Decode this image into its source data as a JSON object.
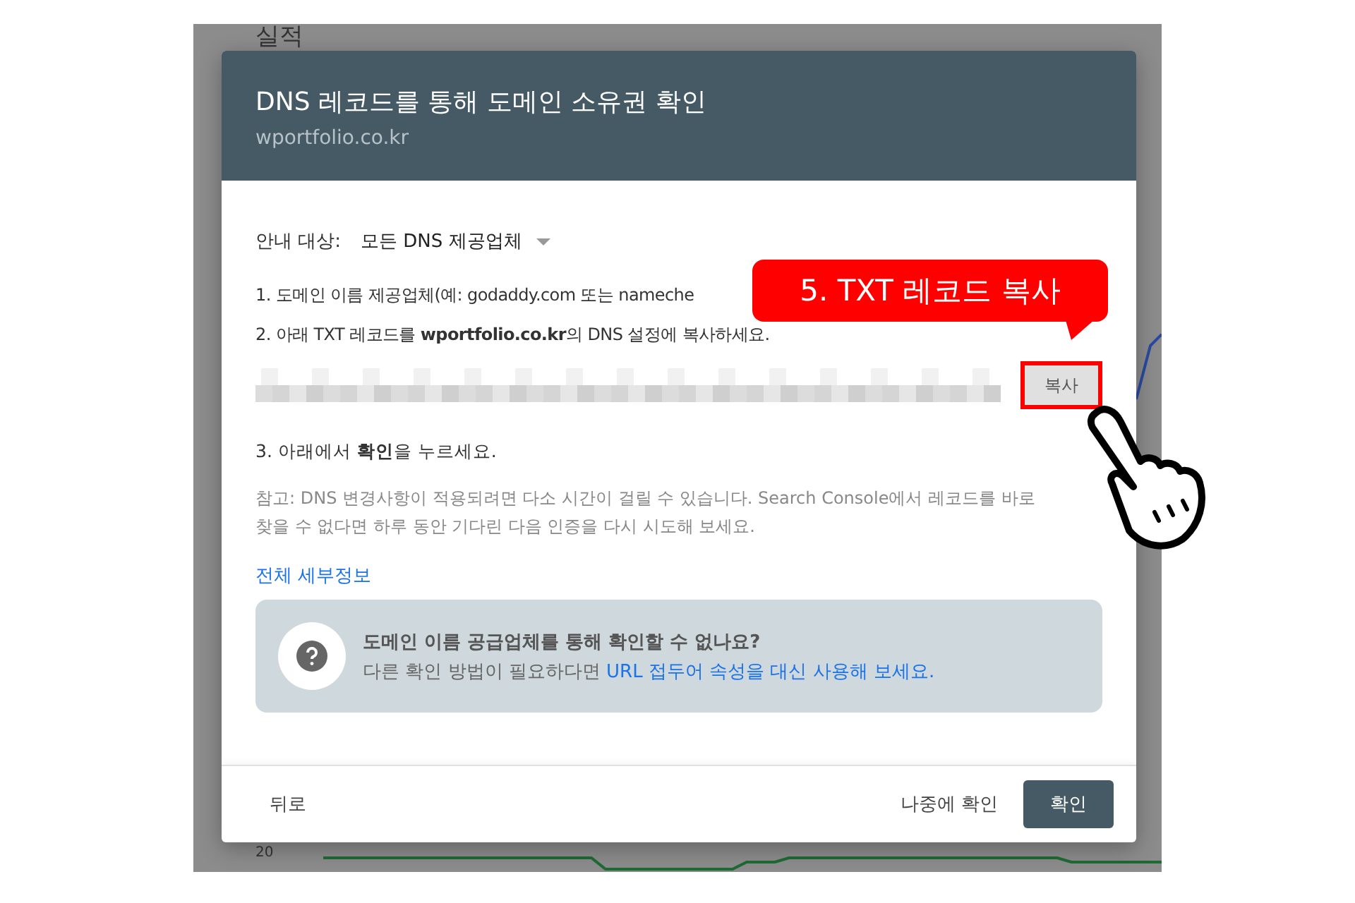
{
  "background": {
    "title": "실적",
    "axis_label": "20"
  },
  "dialog": {
    "title": "DNS 레코드를 통해 도메인 소유권 확인",
    "subtitle": "wportfolio.co.kr",
    "guide": {
      "label": "안내 대상:",
      "value": "모든 DNS 제공업체"
    },
    "steps": [
      "1. 도메인 이름 제공업체(예: godaddy.com 또는 nameche",
      "2. 아래 TXT 레코드를 **wportfolio.co.kr**의 DNS 설정에 복사하세요."
    ],
    "copy_button": {
      "label": "복사",
      "highlighted": true
    },
    "step3": "3. 아래에서 **확인**을 누르세요.",
    "note": [
      "참고: DNS 변경사항이 적용되려면 다소 시간이 걸릴 수 있습니다. Search Console에서 레코드를 바로",
      "찾을 수 없다면 하루 동안 기다린 다음 인증을 다시 시도해 보세요."
    ],
    "details_link": "전체 세부정보",
    "help": {
      "title": "도메인 이름 공급업체를 통해 확인할 수 없나요?",
      "text": "다른 확인 방법이 필요하다면",
      "link": "URL 접두어 속성을 대신 사용해 보세요."
    },
    "footer": {
      "back": "뒤로",
      "later": "나중에 확인",
      "confirm": "확인"
    }
  },
  "callout": "5. TXT 레코드 복사"
}
